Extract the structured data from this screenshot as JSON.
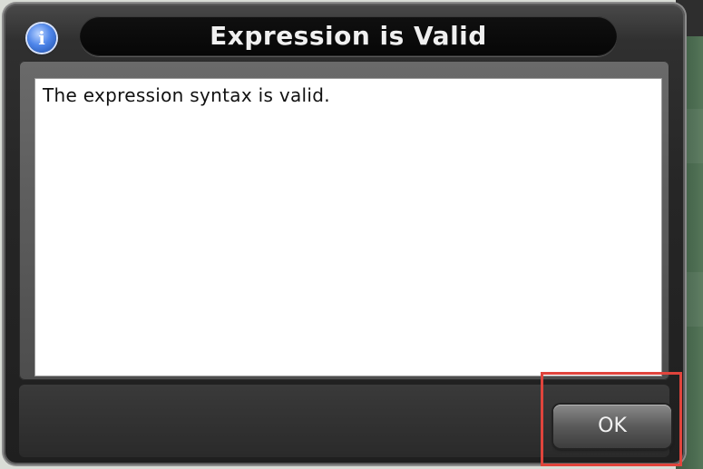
{
  "dialog": {
    "title": "Expression is Valid",
    "icon": "info-icon",
    "icon_glyph": "i",
    "message": "The expression syntax is valid.",
    "ok_label": "OK"
  },
  "colors": {
    "highlight": "#e0443c",
    "icon_blue": "#4f86ea"
  }
}
